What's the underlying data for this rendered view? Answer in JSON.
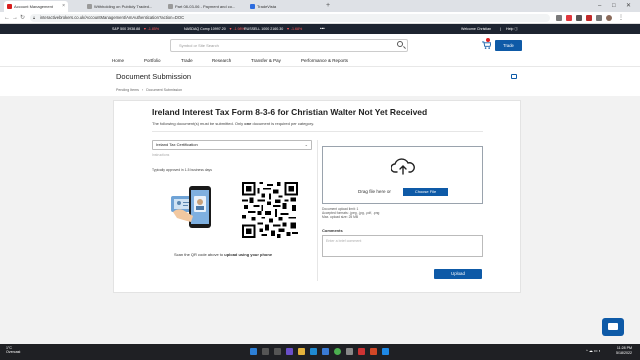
{
  "browser": {
    "tabs": [
      {
        "label": "Account Management",
        "active": true,
        "favicon_color": "#d81e1e"
      },
      {
        "label": "Withholding on Publicly Traded...",
        "active": false,
        "favicon_color": "#9a9a9a"
      },
      {
        "label": "Part 08-03-06 - Payment and co...",
        "active": false,
        "favicon_color": "#9a9a9a"
      },
      {
        "label": "TradeVista",
        "active": false,
        "favicon_color": "#2d6cdf"
      }
    ],
    "new_tab": "+",
    "url": "interactivebrokers.co.uk/AccountManagement/AmAuthentication?action=DOC"
  },
  "ticker": {
    "items": [
      {
        "name": "S&P 500",
        "value": "3938.88",
        "change": "▼ -1.85%"
      },
      {
        "name": "NASDAQ Comp",
        "value": "10997.20",
        "change": "▼ -1.98%"
      },
      {
        "name": "RUSSELL 1000",
        "value": "2160.30",
        "change": "▼ -1.68%"
      }
    ],
    "more": "•••",
    "welcome": "Welcome Christian",
    "help": "Help"
  },
  "header": {
    "search_placeholder": "Symbol or Site Search",
    "trade_button": "Trade",
    "nav": [
      "Home",
      "Portfolio",
      "Trade",
      "Research",
      "Transfer & Pay",
      "Performance & Reports"
    ]
  },
  "page": {
    "title": "Document Submission",
    "breadcrumbs": [
      "Pending Items",
      "Document Submission"
    ],
    "breadcrumb_sep": "›"
  },
  "form": {
    "heading": "Ireland Interest Tax Form 8-3-6 for Christian Walter Not Yet Received",
    "desc_pre": "The following document(s) must be submitted. Only ",
    "desc_bold": "one",
    "desc_post": " document is required per category.",
    "select_value": "Ireland Tax Certification",
    "select_subtext": "Instructions",
    "approval_note": "Typically approved in 1-5 business days",
    "scan_pre": "Scan the QR code above to ",
    "scan_bold": "upload using your phone",
    "drag_text": "Drag file here or",
    "choose_button": "Choose File",
    "limits": [
      "Document upload limit: 1",
      "Accepted formats: .jpeg, .jpg, .pdf, .png",
      "Max. upload size: 25 MB"
    ],
    "comments_label": "Comments",
    "comments_placeholder": "Enter a brief comment",
    "upload_button": "Upload"
  },
  "taskbar": {
    "temp": "1°C",
    "weather": "Overcast",
    "time": "11:28 PM",
    "date": "5/18/2022"
  },
  "colors": {
    "accent": "#0e5aa7",
    "ticker_bg": "#1d2430",
    "negative": "#ff5a5a"
  }
}
